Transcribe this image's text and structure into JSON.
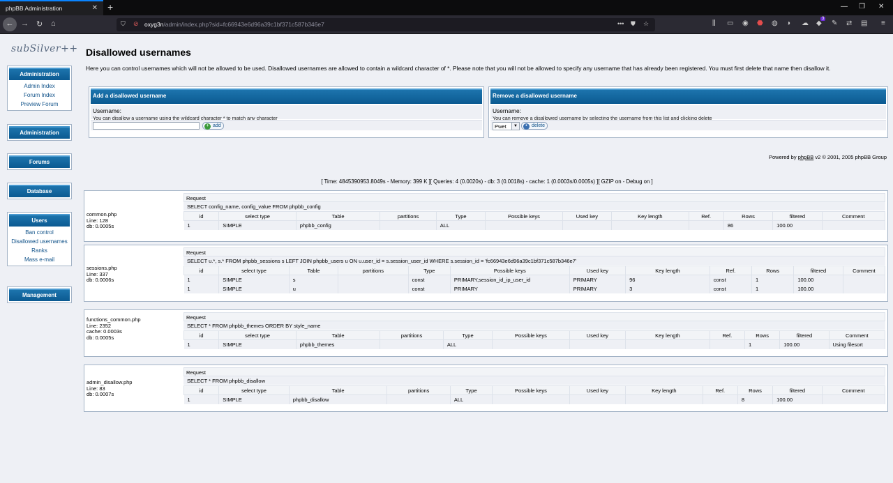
{
  "browser": {
    "tab_title": "phpBB Administration",
    "url_host": "oxyg3n",
    "url_path": "/admin/index.php?sid=fc66943e6d96a39c1bf371c587b346e7",
    "badge_count": "3"
  },
  "logo": {
    "text": "subSilver++"
  },
  "sidebar": {
    "administration": {
      "title": "Administration",
      "links": [
        "Admin Index",
        "Forum Index",
        "Preview Forum"
      ]
    },
    "administration2": {
      "title": "Administration"
    },
    "forums": {
      "title": "Forums"
    },
    "database": {
      "title": "Database"
    },
    "users": {
      "title": "Users",
      "links": [
        "Ban control",
        "Disallowed usernames",
        "Ranks",
        "Mass e-mail"
      ]
    },
    "management": {
      "title": "Management"
    }
  },
  "main": {
    "title": "Disallowed usernames",
    "intro": "Here you can control usernames which will not be allowed to be used. Disallowed usernames are allowed to contain a wildcard character of *. Please note that you will not be allowed to specify any username that has already been registered. You must first delete that name then disallow it.",
    "add_panel": {
      "title": "Add a disallowed username",
      "label": "Username:",
      "hint": "You can disallow a username using the wildcard character * to match any character",
      "input_value": "",
      "button": "add"
    },
    "remove_panel": {
      "title": "Remove a disallowed username",
      "label": "Username:",
      "hint": "You can remove a disallowed username by selecting the username from this list and clicking delete",
      "selected": "Pwet",
      "button": "delete"
    },
    "powered_pre": "Powered by ",
    "powered_link": "phpBB",
    "powered_post": " v2 © 2001, 2005 phpBB Group",
    "debug_line": "[ Time: 4845390953.8049s - Memory: 399 K ][ Queries: 4 (0.0020s) - db: 3 (0.0018s) - cache: 1 (0.0003s/0.0005s) ][ GZIP on - Debug on ]"
  },
  "columns": [
    "id",
    "select type",
    "Table",
    "partitions",
    "Type",
    "Possible keys",
    "Used key",
    "Key length",
    "Ref.",
    "Rows",
    "filtered",
    "Comment"
  ],
  "queries": [
    {
      "file": "common.php",
      "line": "Line: 128",
      "extra": "",
      "db": "db: 0.0005s",
      "request": "Request",
      "sql": "SELECT config_name, config_value FROM phpbb_config",
      "rows": [
        [
          "1",
          "SIMPLE",
          "phpbb_config",
          "",
          "ALL",
          "",
          "",
          "",
          "",
          "86",
          "100.00",
          ""
        ]
      ]
    },
    {
      "file": "sessions.php",
      "line": "Line: 337",
      "extra": "",
      "db": "db: 0.0006s",
      "request": "Request",
      "sql": "SELECT u.*, s.* FROM phpbb_sessions s LEFT JOIN phpbb_users u ON u.user_id = s.session_user_id WHERE s.session_id = 'fc66943e6d96a39c1bf371c587b346e7'",
      "rows": [
        [
          "1",
          "SIMPLE",
          "s",
          "",
          "const",
          "PRIMARY,session_id_ip_user_id",
          "PRIMARY",
          "96",
          "const",
          "1",
          "100.00",
          ""
        ],
        [
          "1",
          "SIMPLE",
          "u",
          "",
          "const",
          "PRIMARY",
          "PRIMARY",
          "3",
          "const",
          "1",
          "100.00",
          ""
        ]
      ]
    },
    {
      "file": "functions_common.php",
      "line": "Line: 2352",
      "extra": "cache: 0.0003s",
      "db": "db: 0.0005s",
      "request": "Request",
      "sql": "SELECT * FROM phpbb_themes ORDER BY style_name",
      "rows": [
        [
          "1",
          "SIMPLE",
          "phpbb_themes",
          "",
          "ALL",
          "",
          "",
          "",
          "",
          "1",
          "100.00",
          "Using filesort"
        ]
      ]
    },
    {
      "file": "admin_disallow.php",
      "line": "Line: 83",
      "extra": "",
      "db": "db: 0.0007s",
      "request": "Request",
      "sql": "SELECT * FROM phpbb_disallow",
      "rows": [
        [
          "1",
          "SIMPLE",
          "phpbb_disallow",
          "",
          "ALL",
          "",
          "",
          "",
          "",
          "8",
          "100.00",
          ""
        ]
      ]
    }
  ]
}
